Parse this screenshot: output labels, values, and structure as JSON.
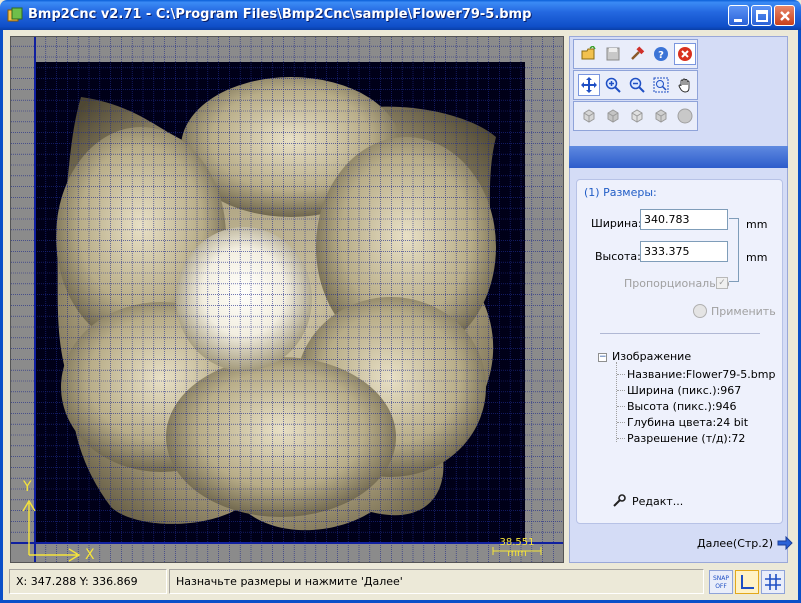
{
  "window": {
    "title": "Bmp2Cnc v2.71 - C:\\Program Files\\Bmp2Cnc\\sample\\Flower79-5.bmp",
    "app_icon": "bmp2cnc-app-icon",
    "controls": [
      "minimize-icon",
      "maximize-icon",
      "close-icon"
    ]
  },
  "canvas": {
    "background_color": "#8B8B8B",
    "image_bg_color": "#000018",
    "grid_color": "#1E2A8A",
    "axis_x_label": "X",
    "axis_y_label": "Y",
    "measure_value": "38.551",
    "measure_unit": "mm"
  },
  "toolbar": {
    "file_tools": [
      "open-folder-icon",
      "save-icon",
      "hammer-icon",
      "help-icon",
      "exit-icon"
    ],
    "view_tools": [
      "move-cross-icon",
      "zoom-in-icon",
      "zoom-out-icon",
      "zoom-fit-icon",
      "hand-pan-icon"
    ],
    "render_tools": [
      "cube-front-icon",
      "cube-left-icon",
      "cube-right-icon",
      "cube-iso-icon",
      "sphere-icon"
    ]
  },
  "sizes": {
    "title": "(1) Размеры:",
    "width_label": "Ширина:",
    "width_value": "340.783",
    "width_unit": "mm",
    "height_label": "Высота:",
    "height_value": "333.375",
    "height_unit": "mm",
    "proportional_label": "Пропорционально",
    "proportional_checked": true,
    "apply_label": "Применить"
  },
  "image_info": {
    "root": "Изображение",
    "items": [
      "Название:Flower79-5.bmp",
      "Ширина (пикс.):967",
      "Высота (пикс.):946",
      "Глубина цвета:24 bit",
      "Разрешение (т/д):72"
    ]
  },
  "actions": {
    "edit_label": "Редакт...",
    "next_label": "Далее(Стр.2)"
  },
  "statusbar": {
    "coords": "X: 347.288 Y: 336.869",
    "message": "Назначьте размеры и нажмите 'Далее'",
    "buttons": [
      "snap-off-icon",
      "axis-icon",
      "grid-icon"
    ]
  }
}
